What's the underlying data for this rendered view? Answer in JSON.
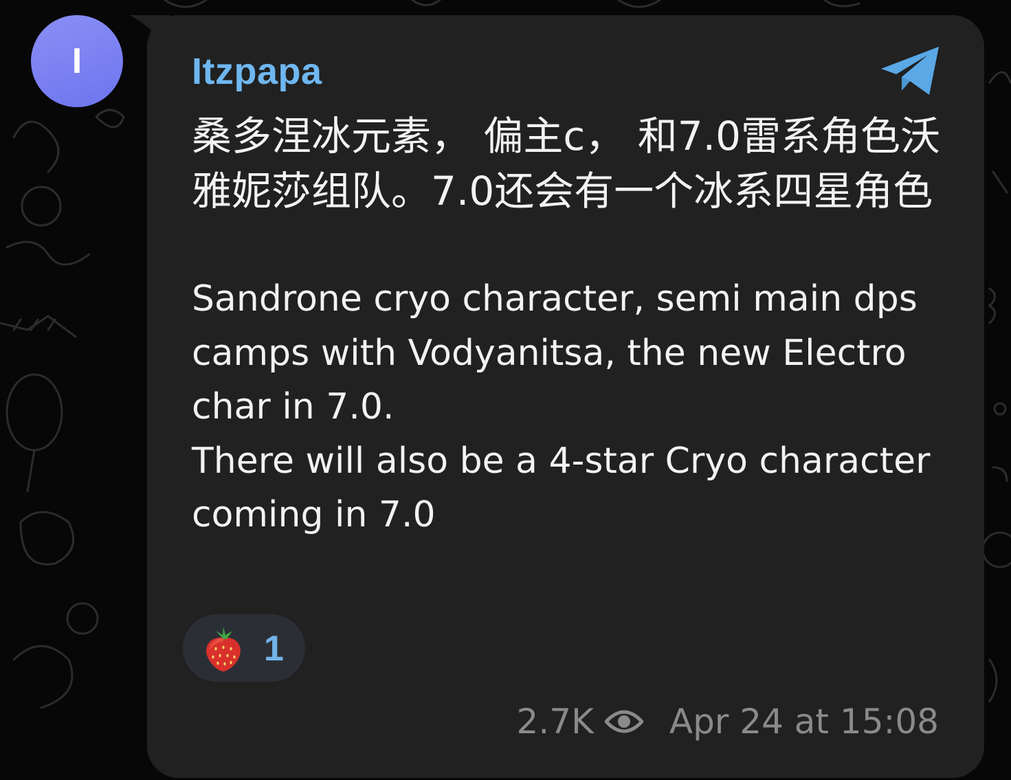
{
  "sender": {
    "avatar_initial": "I",
    "name": "Itzpapa",
    "avatar_color": "#7a80f2",
    "name_color": "#6fb7f0"
  },
  "message": {
    "chinese_text": "桑多涅冰元素， 偏主c， 和7.0雷系角色沃雅妮莎组队。7.0还会有一个冰系四星角色",
    "english_lines": [
      "Sandrone cryo character, semi main dps camps with Vodyanitsa, the new Electro char in 7.0.",
      "There will also be a 4-star Cryo character coming in 7.0"
    ]
  },
  "reaction": {
    "icon": "strawberry-icon",
    "count": "1"
  },
  "meta": {
    "views": "2.7K",
    "views_icon": "eye-icon",
    "timestamp": "Apr 24 at 15:08"
  },
  "source_icon": "telegram-plane-icon",
  "theme": {
    "background": "#070707",
    "bubble": "#212121",
    "accent": "#6fb7f0"
  }
}
